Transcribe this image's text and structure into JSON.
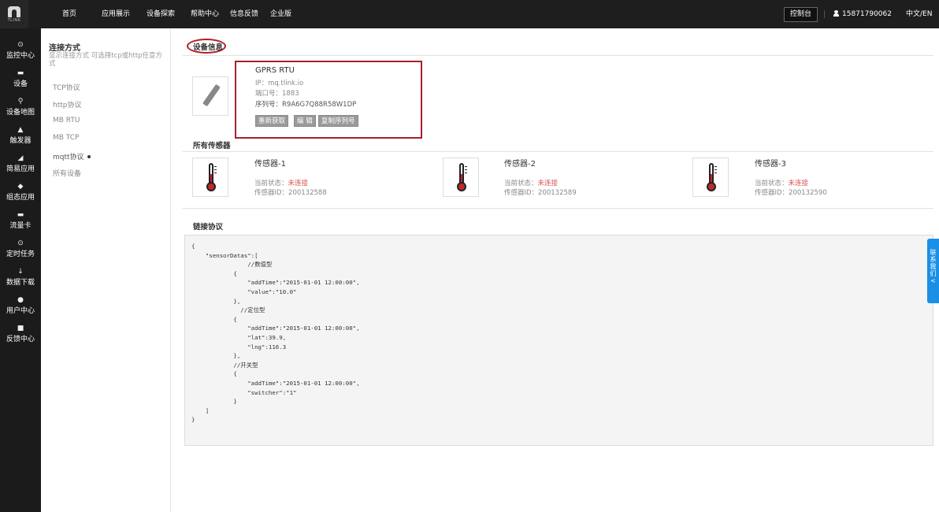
{
  "logo": {
    "word": "TLINK"
  },
  "topnav": [
    "首页",
    "应用展示",
    "设备探索",
    "帮助中心",
    "信息反馈",
    "企业版"
  ],
  "header": {
    "console": "控制台",
    "phone": "15871790062",
    "lang": "中文/EN",
    "user_icon": "user-icon"
  },
  "sidebar": [
    {
      "label": "监控中心",
      "icon": "⊙"
    },
    {
      "label": "设备",
      "icon": "▬"
    },
    {
      "label": "设备地图",
      "icon": "⚲"
    },
    {
      "label": "触发器",
      "icon": "▲"
    },
    {
      "label": "简易应用",
      "icon": "◢"
    },
    {
      "label": "组态应用",
      "icon": "◆"
    },
    {
      "label": "流量卡",
      "icon": "▬"
    },
    {
      "label": "定时任务",
      "icon": "⊙"
    },
    {
      "label": "数据下载",
      "icon": "↓"
    },
    {
      "label": "用户中心",
      "icon": "●"
    },
    {
      "label": "反馈中心",
      "icon": "■"
    }
  ],
  "submenu": {
    "title": "连接方式",
    "desc": "显示连接方式 可选择tcp或http任意方式",
    "items": [
      "TCP协议",
      "http协议",
      "MB RTU",
      "MB TCP",
      "mqtt协议",
      "所有设备"
    ]
  },
  "device": {
    "section_title": "设备信息",
    "name": "GPRS RTU",
    "ip": "IP：mq.tlink.io",
    "port": "端口号：1883",
    "serial": "序列号：R9A6G7Q88R58W1DP",
    "buttons": [
      "重新获取",
      "编 辑",
      "复制序列号"
    ]
  },
  "sensors_title": "所有传感器",
  "sensors": [
    {
      "name": "传感器-1",
      "status_label": "当前状态：",
      "status": "未连接",
      "id": "传感器ID：200132588"
    },
    {
      "name": "传感器-2",
      "status_label": "当前状态：",
      "status": "未连接",
      "id": "传感器ID：200132589"
    },
    {
      "name": "传感器-3",
      "status_label": "当前状态：",
      "status": "未连接",
      "id": "传感器ID：200132590"
    }
  ],
  "protocol": {
    "title": "链接协议",
    "code": "{\n    \"sensorDatas\":[\n                //数值型\n            {\n                \"addTime\":\"2015-01-01 12:00:00\",\n                \"value\":\"10.0\"\n            },\n              //定位型\n            {\n                \"addTime\":\"2015-01-01 12:00:00\",\n                \"lat\":39.9,\n                \"lng\":116.3\n            },\n            //开关型\n            {\n                \"addTime\":\"2015-01-01 12:00:00\",\n                \"switcher\":\"1\"\n            }\n    ]\n}"
  },
  "contact": {
    "text": [
      "联",
      "系",
      "我",
      "们",
      "<"
    ]
  }
}
